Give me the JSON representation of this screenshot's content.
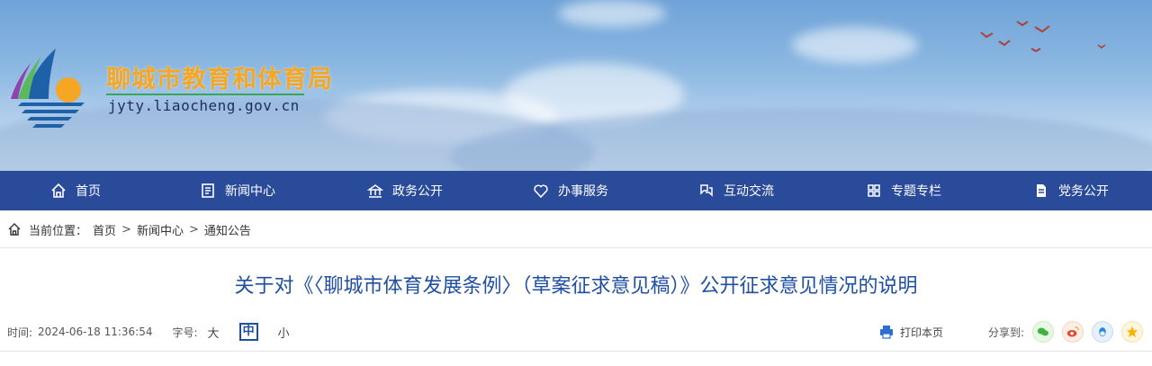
{
  "header": {
    "site_name": "聊城市教育和体育局",
    "site_url": "jyty.liaocheng.gov.cn"
  },
  "nav": {
    "items": [
      {
        "label": "首页",
        "icon": "home-icon"
      },
      {
        "label": "新闻中心",
        "icon": "news-icon"
      },
      {
        "label": "政务公开",
        "icon": "government-icon"
      },
      {
        "label": "办事服务",
        "icon": "heart-icon"
      },
      {
        "label": "互动交流",
        "icon": "interaction-icon"
      },
      {
        "label": "专题专栏",
        "icon": "grid-icon"
      },
      {
        "label": "党务公开",
        "icon": "document-icon"
      }
    ]
  },
  "breadcrumb": {
    "prefix": "当前位置：",
    "items": [
      "首页",
      "新闻中心",
      "通知公告"
    ],
    "separator": ">"
  },
  "article": {
    "title": "关于对《〈聊城市体育发展条例〉（草案征求意见稿）》公开征求意见情况的说明",
    "time_label": "时间:",
    "time_value": "2024-06-18 11:36:54",
    "font_label": "字号:",
    "font_large": "大",
    "font_medium": "中",
    "font_small": "小",
    "print_label": "打印本页",
    "share_label": "分享到:"
  },
  "colors": {
    "nav_bg": "#2a4a9a",
    "title": "#1f4fa3",
    "site_name": "#f5a623"
  }
}
